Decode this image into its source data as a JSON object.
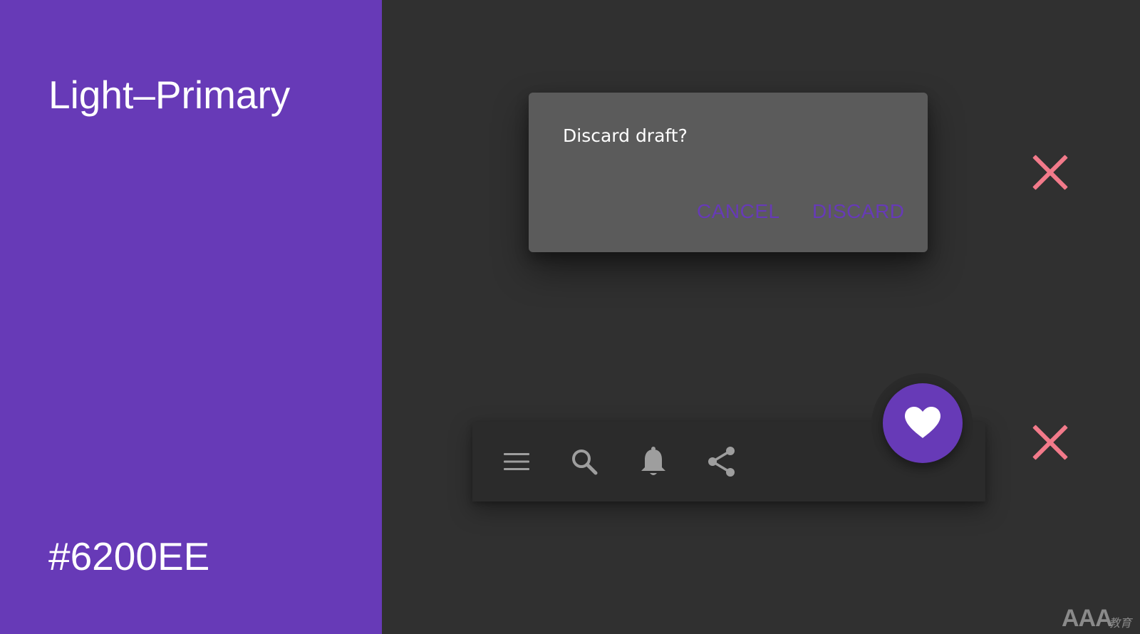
{
  "swatch": {
    "title": "Light–Primary",
    "hex_label": "#6200EE",
    "panel_color": "#673AB7",
    "text_color": "#FFFFFF"
  },
  "dialog": {
    "title": "Discard draft?",
    "cancel_label": "CANCEL",
    "discard_label": "DISCARD",
    "button_color": "#673AB7",
    "surface_color": "#5B5B5B"
  },
  "bottom_bar": {
    "icons": [
      "menu-icon",
      "search-icon",
      "bell-icon",
      "share-icon"
    ],
    "icon_color": "#9E9E9E",
    "surface_color": "#2B2B2B"
  },
  "fab": {
    "icon": "heart-icon",
    "color": "#673AB7",
    "icon_color": "#FFFFFF"
  },
  "status_marks": {
    "icon": "cross-icon",
    "color": "#F27A8A"
  },
  "watermark": {
    "text": "AAA",
    "sub_text": "教育"
  }
}
